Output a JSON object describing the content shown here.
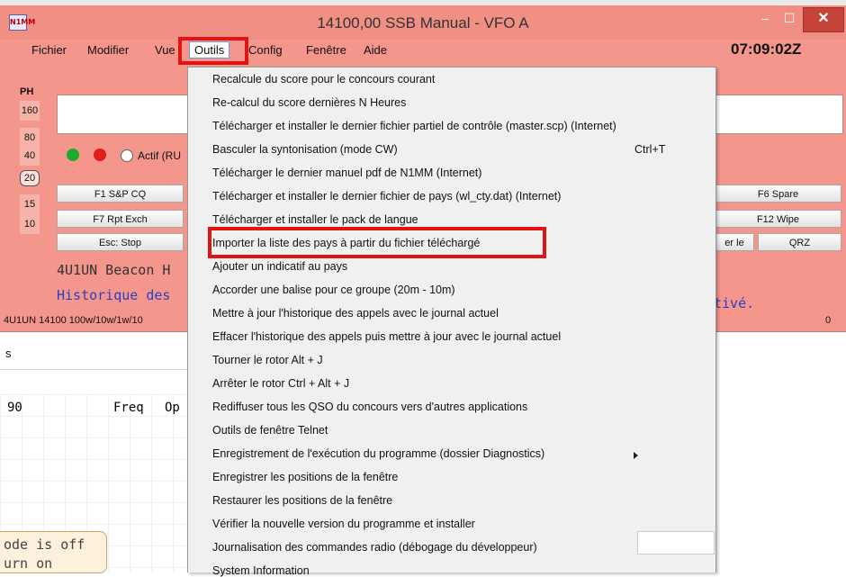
{
  "window": {
    "title": "14100,00 SSB Manual - VFO A",
    "clock": "07:09:02Z",
    "app_icon": "N1MM",
    "controls": {
      "minimize": "–",
      "maximize": "☐",
      "close": "✕"
    }
  },
  "menubar": {
    "items": [
      "Fichier",
      "Modifier",
      "Vue",
      "Outils",
      "Config",
      "Fenêtre",
      "Aide"
    ]
  },
  "bands": {
    "mode": "PH",
    "items": [
      "160",
      "80",
      "40",
      "20",
      "15",
      "10"
    ],
    "selected": "20"
  },
  "radio_label": "Actif (RU",
  "fkeys": {
    "row1_left": "F1 S&P CQ",
    "row1_right": "F6 Spare",
    "row2_left": "F7 Rpt Exch",
    "row2_right": "F12 Wipe",
    "row3_left": "Esc: Stop",
    "row3_mid": "er le",
    "row3_right": "QRZ"
  },
  "info": {
    "beacon": "4U1UN Beacon H",
    "history": "Historique des",
    "history_tail": "tivé.",
    "status_left": "4U1UN 14100 100w/10w/1w/10",
    "status_right": "0"
  },
  "lower": {
    "s_label": "s",
    "col0": "90",
    "col_freq": "Freq",
    "col_op": "Op",
    "tip_line1": "ode is off",
    "tip_line2": "urn on"
  },
  "dropdown": {
    "items": [
      {
        "label": "Recalcule du score pour le concours courant"
      },
      {
        "label": "Re-calcul du score dernières N Heures"
      },
      {
        "label": "Télécharger et installer le dernier fichier partiel de contrôle (master.scp) (Internet)"
      },
      {
        "label": "Basculer la syntonisation (mode CW)",
        "shortcut": "Ctrl+T"
      },
      {
        "label": "Télécharger le dernier manuel pdf de N1MM (Internet)"
      },
      {
        "label": "Télécharger et installer le dernier fichier de pays (wl_cty.dat) (Internet)"
      },
      {
        "label": "Télécharger et installer le pack de langue"
      },
      {
        "label": "Importer la liste des pays à partir du fichier téléchargé"
      },
      {
        "label": "Ajouter un indicatif au pays"
      },
      {
        "label": "Accorder une balise pour ce groupe (20m - 10m)"
      },
      {
        "label": "Mettre à jour l'historique des appels avec le journal actuel"
      },
      {
        "label": "Effacer l'historique des appels puis mettre à jour avec le journal actuel"
      },
      {
        "label": "Tourner le rotor Alt + J"
      },
      {
        "label": "Arrêter le rotor Ctrl + Alt + J"
      },
      {
        "label": "Rediffuser tous les QSO du concours vers d'autres applications"
      },
      {
        "label": "Outils de fenêtre Telnet"
      },
      {
        "label": "Enregistrement de l'exécution du programme (dossier Diagnostics)",
        "submenu": true
      },
      {
        "label": "Enregistrer les positions de la fenêtre"
      },
      {
        "label": "Restaurer les positions de la fenêtre"
      },
      {
        "label": "Vérifier la nouvelle version du programme et installer"
      },
      {
        "label": "Journalisation des commandes radio (débogage du développeur)"
      },
      {
        "label": "System Information"
      }
    ]
  },
  "colors": {
    "window_bg": "#f4968c",
    "highlight_box": "#e01414",
    "history_text": "#2b3fc4",
    "beacon_text": "#333333"
  }
}
